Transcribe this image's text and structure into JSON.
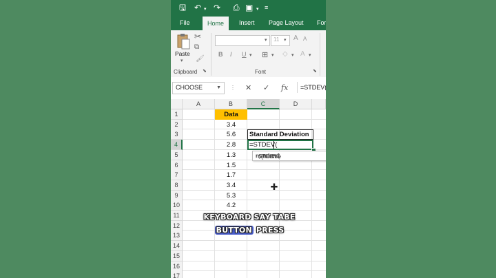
{
  "ribbon": {
    "tabs": [
      "File",
      "Home",
      "Insert",
      "Page Layout",
      "For"
    ],
    "active_tab": "Home",
    "paste_label": "Paste",
    "clipboard_label": "Clipboard",
    "font_group_label": "Font",
    "font_size": "11",
    "format_buttons": [
      "B",
      "I",
      "U"
    ]
  },
  "formula_bar": {
    "name_box": "CHOOSE",
    "formula": "=STDEV("
  },
  "grid": {
    "columns": [
      "A",
      "B",
      "C",
      "D"
    ],
    "rows": [
      "1",
      "2",
      "3",
      "4",
      "5",
      "6",
      "7",
      "8",
      "9",
      "10",
      "11",
      "12",
      "13",
      "14",
      "15",
      "16",
      "17"
    ],
    "data_header": "Data",
    "data_values": [
      "3.4",
      "5.6",
      "2.8",
      "1.3",
      "1.5",
      "1.7",
      "3.4",
      "5.3",
      "4.2"
    ],
    "sd_label": "Standard Deviation",
    "active_cell_text": "=STDEV(",
    "tooltip_fn": "STDEV(",
    "tooltip_arg1": "number1",
    "tooltip_rest": ", [numbe"
  },
  "caption": {
    "line1_a": "KEYBOARD SAY TABE",
    "line2_hl": "BUTTON",
    "line2_rest": " PRESS"
  },
  "colors": {
    "excel_green": "#217346",
    "data_header_fill": "#ffc000",
    "background": "#4e8a60",
    "caption_highlight": "#4b5fd0"
  }
}
